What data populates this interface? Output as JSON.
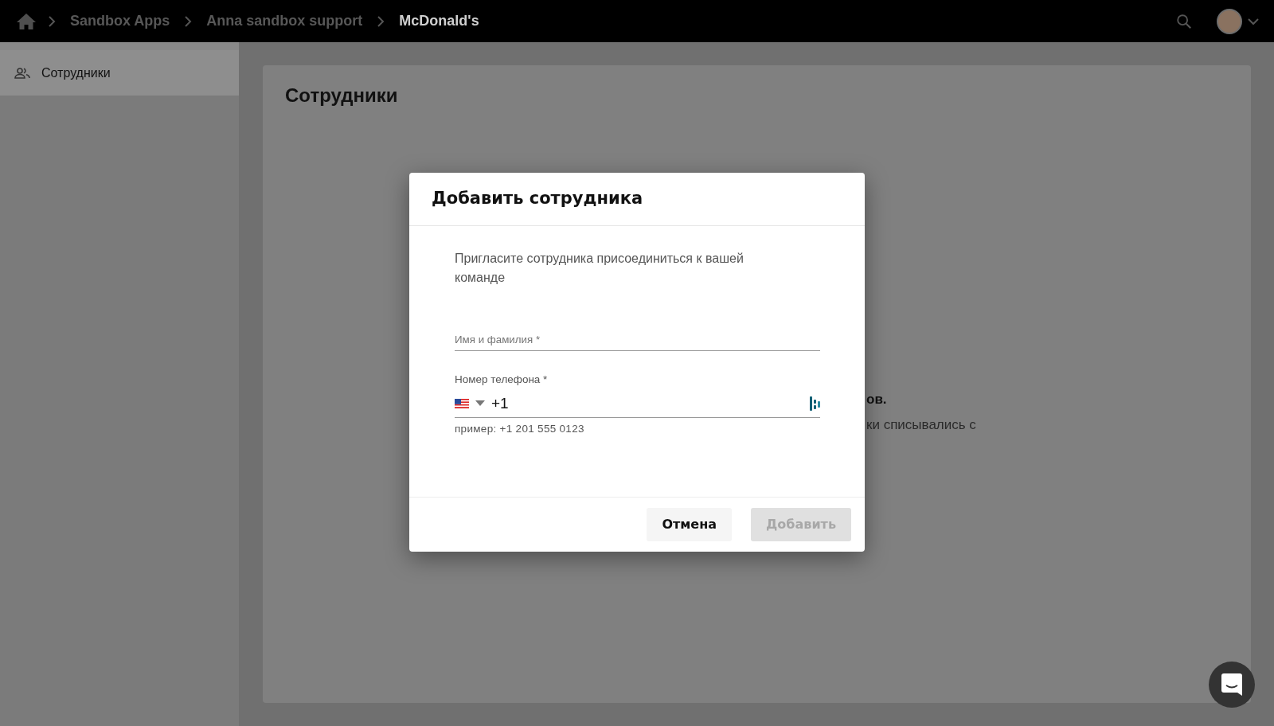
{
  "breadcrumbs": [
    {
      "label": "Sandbox Apps",
      "current": false
    },
    {
      "label": "Anna sandbox support",
      "current": false
    },
    {
      "label": "McDonald's",
      "current": true
    }
  ],
  "sidebar": {
    "items": [
      {
        "label": "Сотрудники",
        "selected": true
      }
    ]
  },
  "page": {
    "title": "Сотрудники",
    "background_texts": [
      "ов.",
      "ки списывались с"
    ]
  },
  "dialog": {
    "title": "Добавить сотрудника",
    "description": "Пригласите сотрудника присоединиться к вашей команде",
    "fields": [
      {
        "kind": "text",
        "placeholder": "Имя и фамилия *"
      },
      {
        "kind": "phone",
        "label": "Номер телефона *",
        "value": "+1",
        "hint": "пример: +1 201 555 0123"
      }
    ],
    "buttons": [
      {
        "label": "Отмена",
        "disabled": false
      },
      {
        "label": "Добавить",
        "disabled": true
      }
    ]
  }
}
